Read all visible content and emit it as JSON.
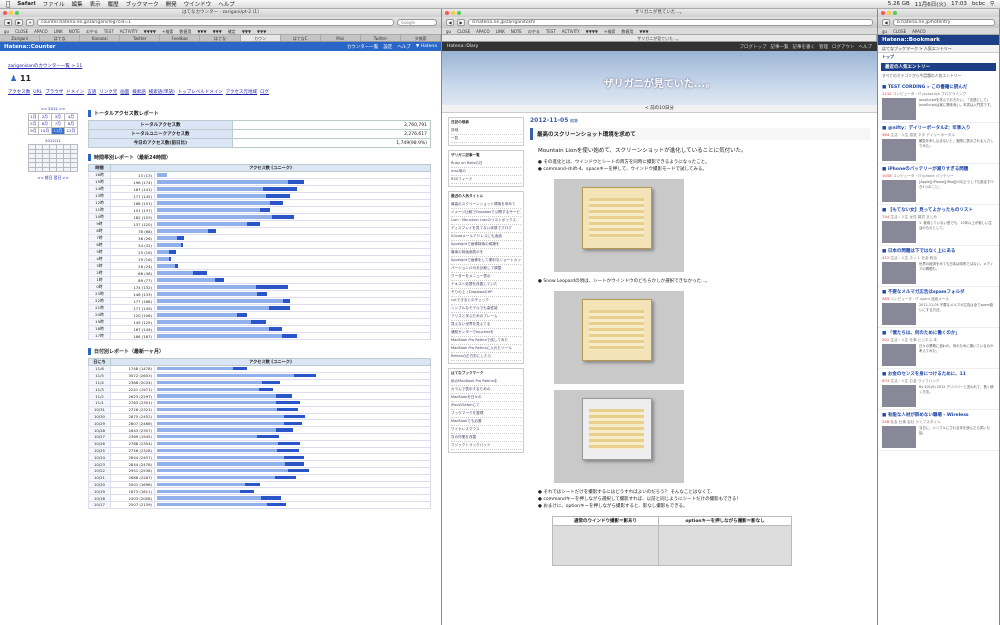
{
  "menubar": {
    "app": "Safari",
    "items": [
      "ファイル",
      "編集",
      "表示",
      "履歴",
      "ブックマーク",
      "開発",
      "ウインドウ",
      "ヘルプ"
    ],
    "status": [
      "5.26 GB",
      "11月6日(火)",
      "17:03",
      "bcbc"
    ]
  },
  "counter_window": {
    "title": "はてなカウンター - zarigani/pt-2 (1)",
    "url": "counter.hatena.ne.jp/zarigani/log?cid=1",
    "search_placeholder": "Google",
    "bookmarks": [
      "gu",
      "CLOSE",
      "APACO",
      "LINK",
      "NOTE",
      "のやる",
      "TEST",
      "ACTIVITY",
      "▼▼▼▼",
      "+検索",
      "数値用",
      "▼▼▼",
      "▼▼▼",
      "確定",
      "▼▼▼",
      "▼▼▼"
    ],
    "tabs": [
      "Zarigani",
      "はてな",
      "Kanazai",
      "Twitter",
      "Feedbac",
      "はてな",
      "カウン",
      "はてなC",
      "Mixi",
      "Twitter",
      "タ検索"
    ],
    "header": {
      "brand": "Hatena::Counter",
      "links": [
        "カウンター一覧",
        "設定",
        "ヘルプ",
        "▼ Hatena"
      ]
    },
    "breadcrumb": "zariganisanのカウンター一覧 > 11",
    "user": "11",
    "navlinks": [
      "アクセス数",
      "URL",
      "ブラウザ",
      "ドメイン",
      "言語",
      "リンク元",
      "画面",
      "検索語",
      "検索語(単語)",
      "トップレベルドメイン",
      "アクセス元地域",
      "ログ"
    ],
    "calendar": {
      "year": "<< 2012 >>",
      "months": [
        [
          "1月",
          "2月",
          "3月",
          "4月"
        ],
        [
          "5月",
          "6月",
          "7月",
          "8月"
        ],
        [
          "9月",
          "10月",
          "11月",
          "12月"
        ]
      ],
      "selected": "11月",
      "month_label": "2012/11",
      "more": "<< 前日 翌日 >>"
    },
    "total_title": "トータルアクセス数レポート",
    "totals": [
      {
        "k": "トータルアクセス数",
        "v": "2,760,791"
      },
      {
        "k": "トータルユニークアクセス数",
        "v": "2,276,617"
      },
      {
        "k": "今日のアクセス数(前日比)",
        "v": "1,749(98.9%)"
      }
    ],
    "hourly_title": "時間帯別レポート（最新24時間）",
    "hourly_head": [
      "時間",
      "アクセス数 (ユニーク)"
    ],
    "hourly": [
      [
        "16時",
        "13 (13)",
        13,
        13
      ],
      [
        "15時",
        "196 (174)",
        196,
        174
      ],
      [
        "14時",
        "187 (141)",
        187,
        141
      ],
      [
        "13時",
        "177 (145)",
        177,
        145
      ],
      [
        "12時",
        "168 (151)",
        168,
        151
      ],
      [
        "11時",
        "151 (137)",
        151,
        137
      ],
      [
        "10時",
        "182 (153)",
        182,
        153
      ],
      [
        "9時",
        "137 (120)",
        137,
        120
      ],
      [
        "8時",
        "78 (68)",
        78,
        68
      ],
      [
        "7時",
        "36 (26)",
        36,
        26
      ],
      [
        "6時",
        "34 (32)",
        34,
        32
      ],
      [
        "5時",
        "25 (16)",
        25,
        16
      ],
      [
        "4時",
        "19 (16)",
        19,
        16
      ],
      [
        "3時",
        "28 (24)",
        28,
        24
      ],
      [
        "2時",
        "66 (48)",
        66,
        48
      ],
      [
        "1時",
        "89 (77)",
        89,
        77
      ],
      [
        "0時",
        "174 (132)",
        174,
        132
      ],
      [
        "23時",
        "146 (133)",
        146,
        133
      ],
      [
        "22時",
        "177 (168)",
        177,
        168
      ],
      [
        "21時",
        "177 (149)",
        177,
        149
      ],
      [
        "20時",
        "120 (106)",
        120,
        106
      ],
      [
        "19時",
        "145 (125)",
        145,
        125
      ],
      [
        "18時",
        "167 (149)",
        167,
        149
      ],
      [
        "17時",
        "186 (167)",
        186,
        167
      ]
    ],
    "daily_title": "日付別レポート（最新一ヶ月）",
    "daily_head": [
      "日にち",
      "アクセス数 (ユニーク)"
    ],
    "daily": [
      [
        "11/6",
        "1748 (1478)",
        1748,
        1478
      ],
      [
        "11/5",
        "3072 (2653)",
        3072,
        2653
      ],
      [
        "11/4",
        "2386 (2034)",
        2386,
        2034
      ],
      [
        "11/3",
        "2241 (1971)",
        2241,
        1971
      ],
      [
        "11/2",
        "2623 (2297)",
        2623,
        2297
      ],
      [
        "11/1",
        "2763 (2301)",
        2763,
        2301
      ],
      [
        "10/31",
        "2726 (2321)",
        2726,
        2321
      ],
      [
        "10/30",
        "2875 (2452)",
        2875,
        2452
      ],
      [
        "10/29",
        "2807 (2466)",
        2807,
        2466
      ],
      [
        "10/28",
        "2643 (2307)",
        2643,
        2307
      ],
      [
        "10/27",
        "2369 (1945)",
        2369,
        1945
      ],
      [
        "10/26",
        "2768 (2354)",
        2768,
        2354
      ],
      [
        "10/25",
        "2756 (2328)",
        2756,
        2328
      ],
      [
        "10/24",
        "2844 (2457)",
        2844,
        2457
      ],
      [
        "10/23",
        "2844 (2478)",
        2844,
        2478
      ],
      [
        "10/22",
        "2951 (2538)",
        2951,
        2538
      ],
      [
        "10/21",
        "2688 (2287)",
        2688,
        2287
      ],
      [
        "10/20",
        "2001 (1698)",
        2001,
        1698
      ],
      [
        "10/19",
        "1873 (1611)",
        1873,
        1611
      ],
      [
        "10/18",
        "2403 (2008)",
        2403,
        2008
      ],
      [
        "10/17",
        "2507 (2139)",
        2507,
        2139
      ]
    ]
  },
  "diary_window": {
    "title": "ザリガニが見ていた...。",
    "url": "d.hatena.ne.jp/zariganitosh/",
    "header_left": "Hatena::Diary",
    "header_links": [
      "ブログトップ",
      "記事一覧",
      "記事を書く",
      "管理",
      "ログアウト",
      "ヘルプ"
    ],
    "banner": "ザリガニが見ていた...。",
    "nav": "< 前の10日分",
    "date": "2012-11-05",
    "date_suffix": "編集",
    "post_title": "最高のスクリーンショット環境を求めて",
    "lead": "Mountain Lionを使い始めて、スクリーンショットが進化していることに気付いた。",
    "bullets": [
      "その進化とは、ウインドウとシートの両方を同時に撮影できるようになったこと。",
      "command-shift-4、spaceキーを押して、ウインドウ撮影モードで試してみる。"
    ],
    "bullet2": "Snow Leopardの頃は、シートかウインドウのどちらかしか選択できなかった...。",
    "bottom_bullets": [
      "それではシートだけを撮影するにはどうすればよいのだろう？ そんなことはなくて、",
      "commandキーを押しながら選択して撮影すれば、以前と同じようにシートだけの撮影もできる！",
      "おまけに、optionキーを押しながら撮影すると、影なし撮影もできる。"
    ],
    "compare_head": [
      "通常のウインドウ撮影＝影あり",
      "optionキーを押しながら撮影＝影なし"
    ],
    "side_boxes": [
      {
        "h": "日記の検索",
        "items": [
          "詳細",
          "一覧"
        ]
      },
      {
        "h": "ザリガニ記事一覧",
        "items": [
          "Ruby on Railsの日",
          "mac用の",
          "RSSフィード"
        ]
      },
      {
        "h": "最近の人気タイトル",
        "items": [
          "最高のスクリーンショット環境を求めて",
          "イメージ比較でDropboxで公開するサービス",
          "Lion・Mountain Lionのリストボックス",
          "ディスプレイを見てない状態でブログ",
          "iCloudメールアドレスにも迷惑",
          "Spotlightで画像検索の候補を",
          "最後の前画面表示を",
          "Spotlightで画像をして便利なショートカット",
          "バージョン(20)を比較して調整",
          "クーターをメニュー表示",
          "テキスト処理を改善していた",
          "そりの上 | DropboxのHP",
          "cutできまとのチェック",
          "シンプルなモデルでも高性能",
          "アリスと学ぶためのフレーム",
          "見えない世界を見えてる",
          "通知センターでtouchesを",
          "MacBook Pro Retinaで試してみた",
          "MacBook Pro Retinaに入れたツール",
          "Retinaの正方形にしたら"
        ]
      },
      {
        "h": "はてなブックマーク",
        "items": [
          "私のMacBook Pro Retinaを",
          "カラムで表示するための",
          "MacBookを日々の",
          "iPadのSafariにて",
          "ブックマークを整理",
          "MacBookでも必要",
          "ワイヤレスマウス",
          "次の作業を改善",
          "マジックトラックパッド"
        ]
      }
    ]
  },
  "bookmark_window": {
    "title": "Hatena::Bookmark",
    "url": "b.hatena.ne.jp/hotentry",
    "header": "Hatena::Bookmark",
    "sub": "はてなブックマーク > 人気エントリー",
    "tab": "トップ",
    "section": "最近の人気エントリー",
    "desc": "すべてのカテゴリから今話題の人気エントリー",
    "entries": [
      {
        "title": "TEST CORDING » この書籍に読んだ",
        "meta": "コンピュータ・IT javascript プログラミング",
        "text": "JavaScriptを学んでおきたい。「言語として」JavaScriptは実に興味深い。本書は入門書です。",
        "count": "1212"
      },
      {
        "title": "@nifty：デイリーポータルZ：年季入り",
        "meta": "生活・人生 感覚 ネタ デイリーポータル",
        "text": "観覧を申し込まないと、実際に表示される入力してみた。",
        "count": "564"
      },
      {
        "title": "iPhoneのバッテリーが減りすぎる問題",
        "meta": "コンピュータ・IT iphone バッテリー",
        "text": "[Apple][iPhone][iPad][iOS]どうしても設定すべき1つのこと。",
        "count": "1058"
      },
      {
        "title": "【もてない女】見ってよかったものリスト",
        "meta": "生活・人生 女性 雑貨 まとめ",
        "text": "1. 使用していない型でも、10年以上が新しい生活のものとして。",
        "count": "744"
      },
      {
        "title": "日本の問題は下ではなく上にある",
        "meta": "生活・人生 ネット 社会 政治",
        "text": "世界の経済をみても日本は特別ではない。メディアの問題も。",
        "count": "412"
      },
      {
        "title": "不要なメルマガ広告はspamフォルダ",
        "meta": "コンピュータ・IT spam 迷惑メール",
        "text": "2012-11-05 不要なメルマガ広告は全てspam扱いにする方法。",
        "count": "389"
      },
      {
        "title": "「僕たちは、何のために働くのか」",
        "meta": "生活・人生 仕事 ビジネス 本",
        "text": "日々の業務に追われ、何のために働いているのか考えてみた。",
        "count": "502"
      },
      {
        "title": "お金のセンスを身につけるために、11",
        "meta": "生活・人生 お金 ライフハック",
        "text": "By 401(K) 2012 デリバリーと言われて、長く続く方法。",
        "count": "633"
      },
      {
        "title": "有能な人材が辞めない職場 - Wireless",
        "meta": "社会 仕事 会社 ライフスタイル",
        "text": "当日に、シンプルにされる本を読んだら書いた話。",
        "count": "298"
      }
    ]
  }
}
